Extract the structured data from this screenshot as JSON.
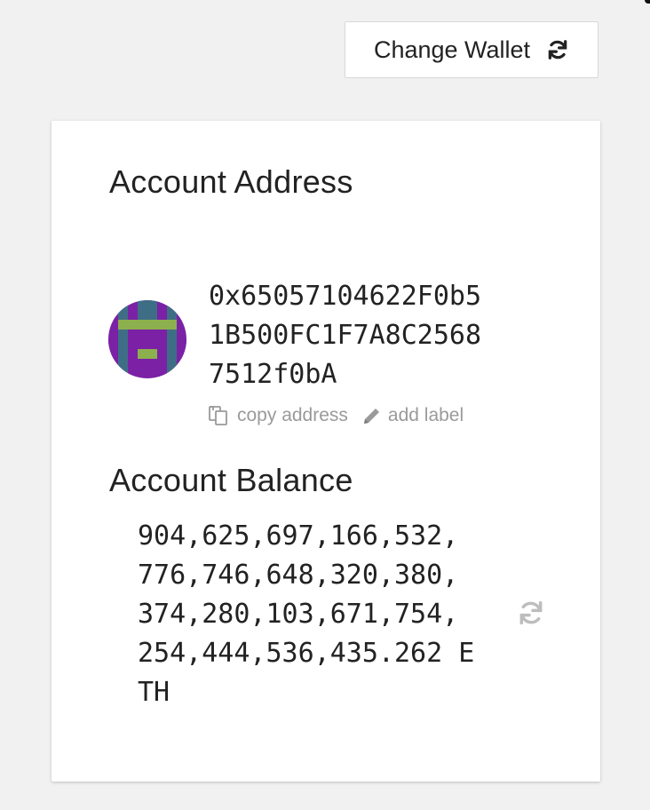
{
  "header": {
    "change_wallet_label": "Change Wallet"
  },
  "account": {
    "address_title": "Account Address",
    "address_lines": "0x65057104622F0b5\n1B500FC1F7A8C2568\n7512f0bA",
    "copy_address_label": "copy address",
    "add_label_label": "add label",
    "balance_title": "Account Balance",
    "balance_lines": "904,625,697,166,532,\n776,746,648,320,380,\n374,280,103,671,754,\n254,444,536,435.262 E\nTH"
  },
  "colors": {
    "page_background": "#f1f1f1",
    "card_background": "#ffffff",
    "muted_text": "#9a9a9a",
    "identicon_purple": "#7b21a6",
    "identicon_teal": "#3e6e86",
    "identicon_green": "#8db04e"
  },
  "icons": {
    "change_wallet": "refresh-icon",
    "copy_address": "copy-icon",
    "add_label": "pencil-icon",
    "refresh_balance": "refresh-icon"
  }
}
